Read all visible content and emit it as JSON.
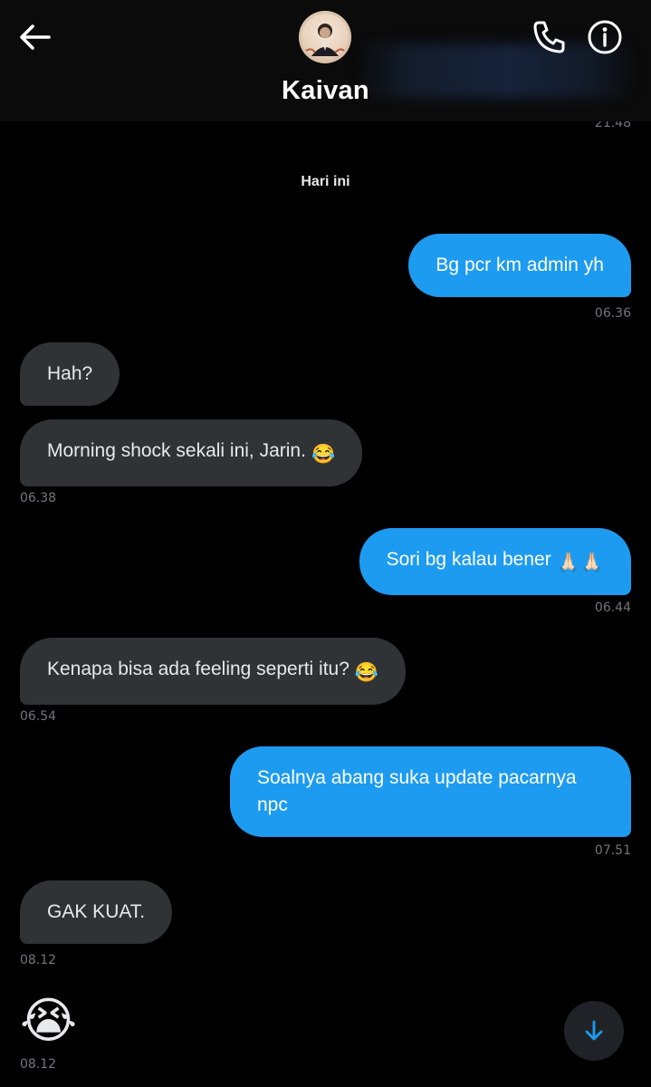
{
  "header": {
    "contact_name": "Kaivan",
    "prev_time": "21.48",
    "icons": [
      "back-arrow-icon",
      "phone-icon",
      "info-icon",
      "avatar"
    ]
  },
  "day_separator": "Hari ini",
  "messages": [
    {
      "dir": "out",
      "text": "Bg pcr km admin yh",
      "time": "06.36"
    },
    {
      "dir": "in",
      "text": "Hah?",
      "time": ""
    },
    {
      "dir": "in",
      "text": "Morning shock sekali ini, Jarin.",
      "emoji": "😂",
      "time": "06.38"
    },
    {
      "dir": "out",
      "text": "Sori bg kalau bener",
      "emoji": "🙏🏻🙏🏻",
      "time": "06.44"
    },
    {
      "dir": "in",
      "text": "Kenapa bisa ada feeling seperti itu?",
      "emoji": "😂",
      "time": "06.54"
    },
    {
      "dir": "out",
      "text": "Soalnya abang suka update pacarnya npc",
      "time": "07.51"
    },
    {
      "dir": "in",
      "text": "GAK KUAT.",
      "time": "08.12"
    },
    {
      "dir": "in",
      "emoji_only": "😭",
      "time": "08.12"
    }
  ],
  "colors": {
    "background": "#000000",
    "outgoing_bubble": "#1d9bf0",
    "incoming_bubble": "#2f3336",
    "timestamp": "#71767b"
  }
}
